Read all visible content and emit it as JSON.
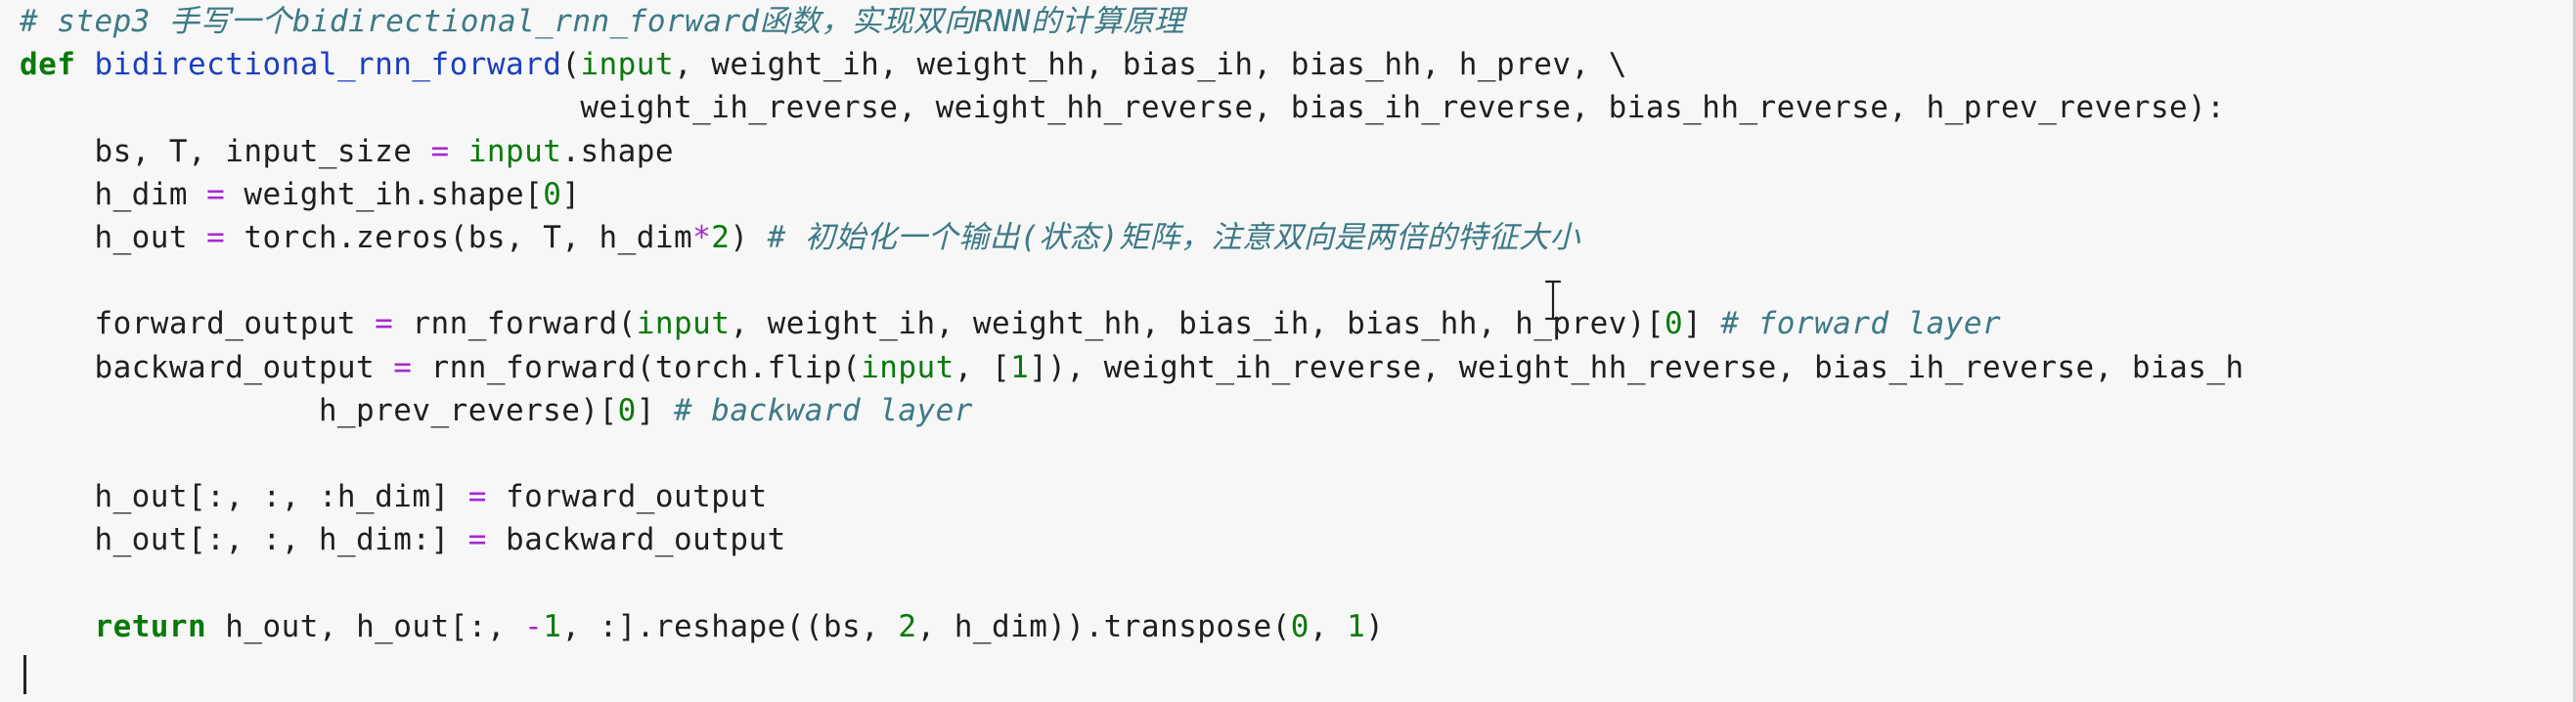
{
  "editor": {
    "lines": [
      [
        {
          "t": "# step3 手写一个bidirectional_rnn_forward函数，实现双向RNN的计算原理",
          "c": "c"
        }
      ],
      [
        {
          "t": "def",
          "c": "k"
        },
        {
          "t": " ",
          "c": "t"
        },
        {
          "t": "bidirectional_rnn_forward",
          "c": "f"
        },
        {
          "t": "(",
          "c": "t"
        },
        {
          "t": "input",
          "c": "bi"
        },
        {
          "t": ", weight_ih, weight_hh, bias_ih, bias_hh, h_prev, \\",
          "c": "t"
        }
      ],
      [
        {
          "t": "                              weight_ih_reverse, weight_hh_reverse, bias_ih_reverse, bias_hh_reverse, h_prev_reverse):",
          "c": "t"
        }
      ],
      [
        {
          "t": "    bs, T, input_size ",
          "c": "t"
        },
        {
          "t": "=",
          "c": "o"
        },
        {
          "t": " ",
          "c": "t"
        },
        {
          "t": "input",
          "c": "bi"
        },
        {
          "t": ".shape",
          "c": "t"
        }
      ],
      [
        {
          "t": "    h_dim ",
          "c": "t"
        },
        {
          "t": "=",
          "c": "o"
        },
        {
          "t": " weight_ih.shape[",
          "c": "t"
        },
        {
          "t": "0",
          "c": "n"
        },
        {
          "t": "]",
          "c": "t"
        }
      ],
      [
        {
          "t": "    h_out ",
          "c": "t"
        },
        {
          "t": "=",
          "c": "o"
        },
        {
          "t": " torch.zeros(bs, T, h_dim",
          "c": "t"
        },
        {
          "t": "*",
          "c": "o"
        },
        {
          "t": "2",
          "c": "n"
        },
        {
          "t": ") ",
          "c": "t"
        },
        {
          "t": "# 初始化一个输出(状态)矩阵，注意双向是两倍的特征大小",
          "c": "c"
        }
      ],
      [
        {
          "t": "",
          "c": "t"
        }
      ],
      [
        {
          "t": "    forward_output ",
          "c": "t"
        },
        {
          "t": "=",
          "c": "o"
        },
        {
          "t": " rnn_forward(",
          "c": "t"
        },
        {
          "t": "input",
          "c": "bi"
        },
        {
          "t": ", weight_ih, weight_hh, bias_ih, bias_hh, h_prev)[",
          "c": "t"
        },
        {
          "t": "0",
          "c": "n"
        },
        {
          "t": "] ",
          "c": "t"
        },
        {
          "t": "# forward layer",
          "c": "c"
        }
      ],
      [
        {
          "t": "    backward_output ",
          "c": "t"
        },
        {
          "t": "=",
          "c": "o"
        },
        {
          "t": " rnn_forward(torch.flip(",
          "c": "t"
        },
        {
          "t": "input",
          "c": "bi"
        },
        {
          "t": ", [",
          "c": "t"
        },
        {
          "t": "1",
          "c": "n"
        },
        {
          "t": "]), weight_ih_reverse, weight_hh_reverse, bias_ih_reverse, bias_h",
          "c": "t"
        }
      ],
      [
        {
          "t": "                h_prev_reverse)[",
          "c": "t"
        },
        {
          "t": "0",
          "c": "n"
        },
        {
          "t": "] ",
          "c": "t"
        },
        {
          "t": "# backward layer",
          "c": "c"
        }
      ],
      [
        {
          "t": "",
          "c": "t"
        }
      ],
      [
        {
          "t": "    h_out[:, :, :h_dim] ",
          "c": "t"
        },
        {
          "t": "=",
          "c": "o"
        },
        {
          "t": " forward_output",
          "c": "t"
        }
      ],
      [
        {
          "t": "    h_out[:, :, h_dim:] ",
          "c": "t"
        },
        {
          "t": "=",
          "c": "o"
        },
        {
          "t": " backward_output",
          "c": "t"
        }
      ],
      [
        {
          "t": "",
          "c": "t"
        }
      ],
      [
        {
          "t": "    ",
          "c": "t"
        },
        {
          "t": "return",
          "c": "k"
        },
        {
          "t": " h_out, h_out[:, ",
          "c": "t"
        },
        {
          "t": "-",
          "c": "o"
        },
        {
          "t": "1",
          "c": "n"
        },
        {
          "t": ", :].reshape((bs, ",
          "c": "t"
        },
        {
          "t": "2",
          "c": "n"
        },
        {
          "t": ", h_dim)).transpose(",
          "c": "t"
        },
        {
          "t": "0",
          "c": "n"
        },
        {
          "t": ", ",
          "c": "t"
        },
        {
          "t": "1",
          "c": "n"
        },
        {
          "t": ")",
          "c": "t"
        }
      ]
    ]
  },
  "colors": {
    "keyword": "#0a7a0a",
    "function_name": "#1a3fbf",
    "builtin": "#0a7a0a",
    "operator": "#a52ad0",
    "number": "#0a7a0a",
    "comment": "#3d7a86",
    "text": "#1f1f1f",
    "cell_background": "#f7f7f7"
  },
  "icons": {
    "mouse_cursor": "text-ibeam-cursor-icon"
  }
}
